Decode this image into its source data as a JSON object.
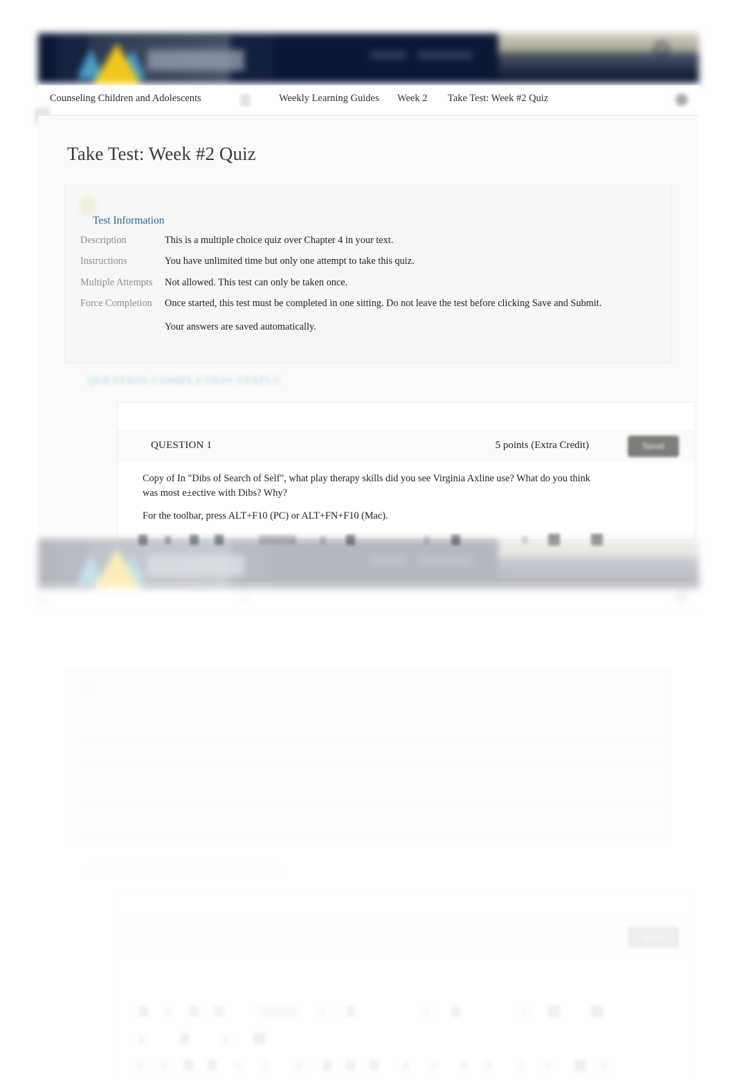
{
  "breadcrumb": {
    "items": [
      {
        "label": "Counseling Children and Adolescents"
      },
      {
        "label": "Weekly Learning Guides"
      },
      {
        "label": "Week 2"
      },
      {
        "label": "Take Test: Week #2 Quiz"
      }
    ],
    "menu_icon": "menu-icon",
    "settings_icon": "gear-icon",
    "separator_icon": "chevron-right-icon"
  },
  "header": {
    "search_icon": "search-icon",
    "logo_alt": "university-logo"
  },
  "page": {
    "title": "Take Test: Week #2 Quiz"
  },
  "test_information": {
    "heading": "Test Information",
    "info_icon": "info-icon",
    "rows": [
      {
        "label": "Description",
        "value": "This is a multiple choice quiz over Chapter 4 in your text."
      },
      {
        "label": "Instructions",
        "value": "You have unlimited time but only one attempt to take this quiz."
      },
      {
        "label": "Multiple Attempts",
        "value": "Not allowed. This test can only be taken once."
      },
      {
        "label": "Force Completion",
        "value": "Once started, this test must be completed in one sitting. Do not leave the test before clicking",
        "value_emphasis": "Save and Submit",
        "value_tail": ".",
        "value_secondary": "Your answers are saved automatically."
      }
    ]
  },
  "question_completion_status": {
    "heading": "QUESTION COMPLETION STATUS"
  },
  "question": {
    "number_label": "QUESTION 1",
    "points_label": "5 points (Extra Credit)",
    "save_status": "Saved",
    "prompt": "Copy of In \"Dibs of Search of Self\", what play therapy skills did you see Virginia Axline use? What do you think was most e±ective with Dibs? Why?",
    "toolbar_hint": "For the toolbar, press ALT+F10 (PC) or ALT+FN+F10 (Mac).",
    "editor_toolbar": {
      "row1_icons": [
        "bold-icon",
        "italic-icon",
        "underline-icon",
        "strikethrough-icon",
        "paragraph-format-select",
        "font-family-select",
        "font-size-select",
        "text-color-icon",
        "highlight-color-icon"
      ],
      "row2_icons": [
        "align-left-icon",
        "bullet-list-icon",
        "numbered-list-icon",
        "table-icon"
      ],
      "row3_icons": [
        "cut-icon",
        "copy-icon",
        "paste-icon",
        "undo-icon",
        "redo-icon",
        "link-icon",
        "unlink-icon",
        "image-icon",
        "video-icon",
        "attachment-icon",
        "math-icon",
        "code-icon",
        "spellcheck-icon",
        "fullscreen-icon",
        "help-icon",
        "preview-icon",
        "source-icon",
        "accessibility-icon"
      ]
    }
  },
  "colors": {
    "brand_navy": "#0a1733",
    "brand_yellow": "#f2c71c",
    "brand_blue": "#4a9fc4",
    "link_blue": "#2b6a96",
    "heading_blue": "#bfe0ea",
    "saved_badge": "#7b7f79",
    "panel_bg": "#f7f7f7",
    "page_bg": "#ffffff"
  }
}
